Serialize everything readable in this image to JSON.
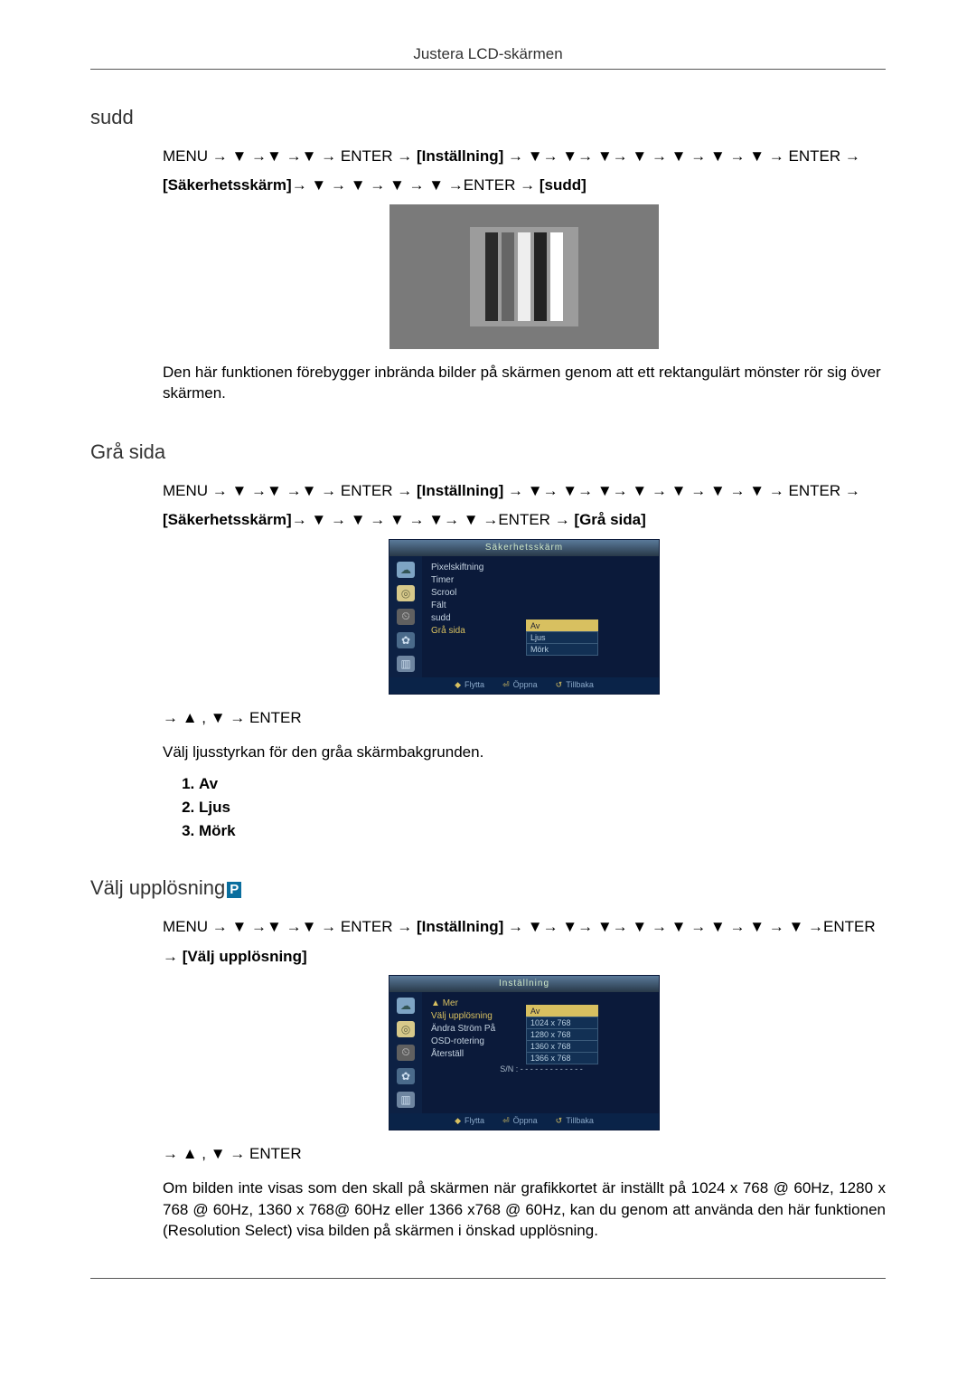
{
  "header": {
    "title": "Justera LCD-skärmen"
  },
  "sudd": {
    "title": "sudd",
    "nav_parts": {
      "menu": "MENU",
      "enter": "ENTER",
      "installning_tag": "[Inställning]",
      "sakerhetsskarm_tag": "[Säkerhetsskärm]",
      "sudd_tag": "[sudd]"
    },
    "desc": "Den här funktionen förebygger inbrända bilder på skärmen genom att ett rektangulärt mönster rör sig över skärmen."
  },
  "gra_sida": {
    "title": "Grå sida",
    "nav_parts": {
      "menu": "MENU",
      "enter": "ENTER",
      "installning_tag": "[Inställning]",
      "sakerhetsskarm_tag": "[Säkerhetsskärm]",
      "gra_sida_tag": "[Grå sida]"
    },
    "osd": {
      "osd_title": "Säkerhetsskärm",
      "items": [
        "Pixelskiftning",
        "Timer",
        "Scrool",
        "Fält",
        "sudd",
        "Grå sida"
      ],
      "options": [
        "Av",
        "Ljus",
        "Mörk"
      ],
      "footer": {
        "move": "Flytta",
        "open": "Öppna",
        "back": "Tillbaka"
      }
    },
    "post_nav": "→ ▲ , ▼ → ENTER",
    "desc": "Välj ljusstyrkan för den gråa skärmbakgrunden.",
    "options_list": [
      "Av",
      "Ljus",
      "Mörk"
    ]
  },
  "valj_upplosning": {
    "title": "Välj upplösning",
    "nav_parts": {
      "menu": "MENU",
      "enter": "ENTER",
      "installning_tag": "[Inställning]",
      "valj_tag": "[Välj upplösning]"
    },
    "osd": {
      "osd_title": "Inställning",
      "items_top": "Mer",
      "items": [
        "Välj upplösning",
        "Ändra Ström På",
        "OSD-rotering",
        "Återställ"
      ],
      "options": [
        "Av",
        "1024 x 768",
        "1280 x 768",
        "1360 x 768",
        "1366 x 768"
      ],
      "sn_label": "S/N :",
      "sn_value": "- - - - - - - - - - - - -",
      "footer": {
        "move": "Flytta",
        "open": "Öppna",
        "back": "Tillbaka"
      }
    },
    "post_nav": "→ ▲ , ▼ → ENTER",
    "desc": "Om bilden inte visas som den skall på skärmen när grafikkortet är inställt på 1024 x 768 @ 60Hz, 1280 x 768 @ 60Hz, 1360 x 768@ 60Hz eller 1366 x768 @ 60Hz, kan du genom att använda den här funktionen (Resolution Select) visa bilden på skärmen i önskad upplösning."
  }
}
